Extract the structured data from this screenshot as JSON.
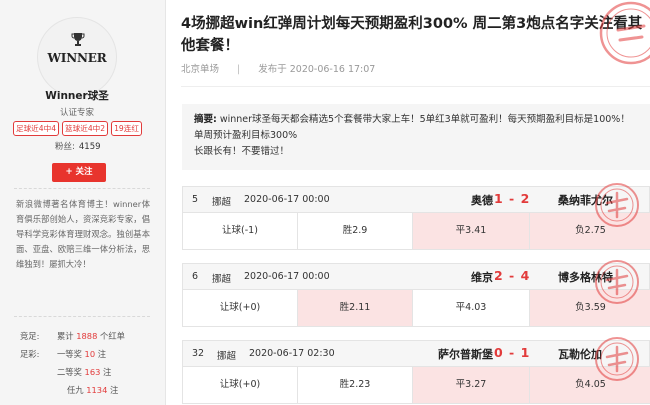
{
  "profile": {
    "avatar_text": "WINNER",
    "name": "Winner球圣",
    "role": "认证专家",
    "badges": [
      "足球近4中4",
      "篮球近4中2",
      "19连红"
    ],
    "fans_label": "粉丝:",
    "fans_count": "4159",
    "follow_label": "+ 关注",
    "bio": "新浪微博著名体育博主！winner体育俱乐部创始人，资深竞彩专家，倡导科学竞彩体育理财观念。独创基本面、亚盘、欧赔三维一体分析法，思维独到！屡抓大冷！"
  },
  "stats": {
    "jingzu_label": "竞足:",
    "jingzu_prefix": "累计",
    "jingzu_count": "1888",
    "jingzu_suffix": "个红单",
    "zucai_label": "足彩:",
    "yideng_label": "一等奖",
    "yideng_count": "10",
    "erdeng_label": "二等奖",
    "erdeng_count": "163",
    "renjiu_label": "任九",
    "renjiu_count": "1134",
    "zhu": "注"
  },
  "article": {
    "title": "4场挪超win红弹周计划每天预期盈利300% 周二第3炮点名字关注看其他套餐！",
    "source": "北京单场",
    "sep": "|",
    "published": "发布于 2020-06-16 17:07",
    "summary_label": "摘要:",
    "summary_text": "winner球圣每天都会精选5个套餐带大家上车！5单红3单就可盈利！每天预期盈利目标是100%！单周预计盈利目标300%",
    "summary_text2": "长跟长有！不要错过！"
  },
  "matches": [
    {
      "num": "5",
      "league": "挪超",
      "time": "2020-06-17 00:00",
      "home": "奥德",
      "score": "1 - 2",
      "away": "桑纳菲尤尔",
      "handicap": "让球(-1)",
      "win": "胜2.9",
      "draw": "平3.41",
      "lose": "负2.75",
      "highlight": [
        false,
        false,
        true,
        true
      ]
    },
    {
      "num": "6",
      "league": "挪超",
      "time": "2020-06-17 00:00",
      "home": "维京",
      "score": "2 - 4",
      "away": "博多格林特",
      "handicap": "让球(+0)",
      "win": "胜2.11",
      "draw": "平4.03",
      "lose": "负3.59",
      "highlight": [
        false,
        true,
        false,
        true
      ]
    },
    {
      "num": "32",
      "league": "挪超",
      "time": "2020-06-17 02:30",
      "home": "萨尔普斯堡",
      "score": "0 - 1",
      "away": "瓦勒伦加",
      "handicap": "让球(+0)",
      "win": "胜2.23",
      "draw": "平3.27",
      "lose": "负4.05",
      "highlight": [
        false,
        false,
        true,
        true
      ]
    }
  ],
  "colors": {
    "accent": "#e8342d",
    "score_red": "#e23b3b",
    "highlight": "#fbe3e3"
  },
  "icons": {
    "avatar_logo": "trophy-icon",
    "stamp": "red-stamp-icon"
  }
}
